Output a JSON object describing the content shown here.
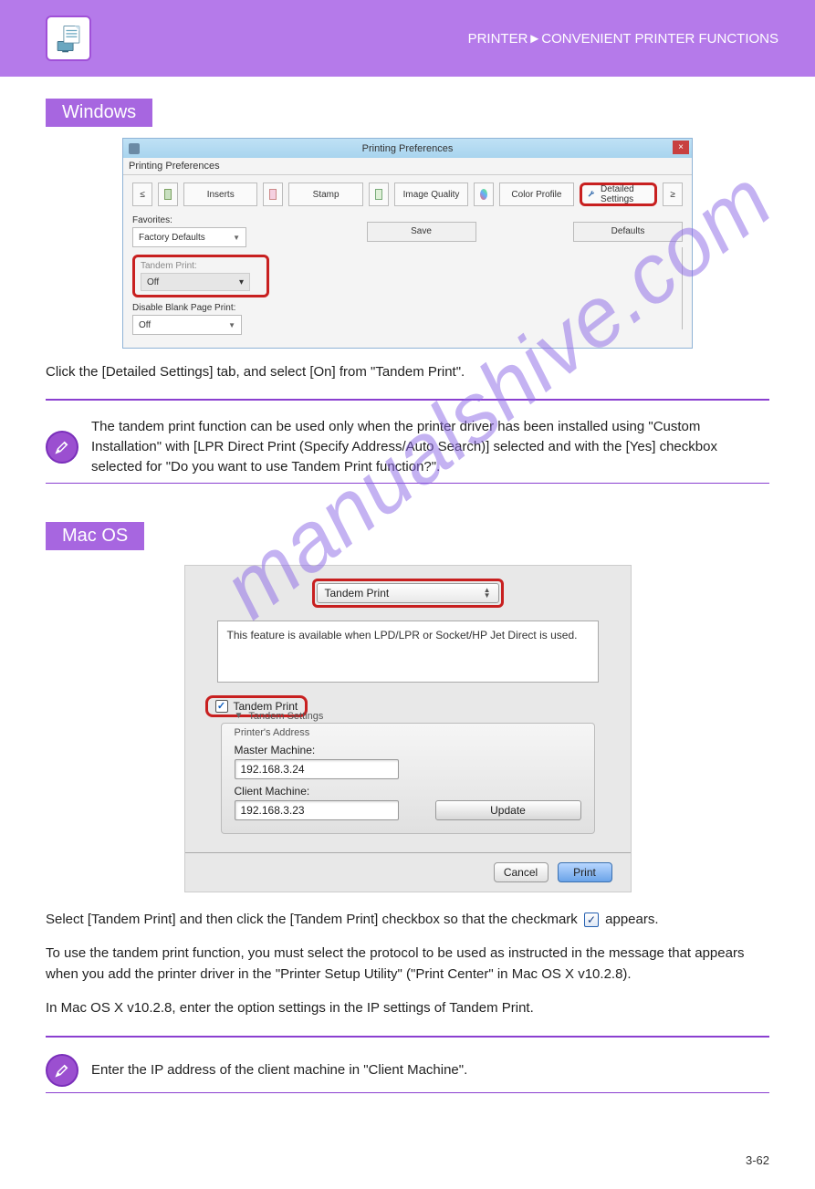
{
  "header": {
    "breadcrumb": "PRINTER►CONVENIENT PRINTER FUNCTIONS"
  },
  "windows": {
    "badge": "Windows",
    "dialog": {
      "title": "Printing Preferences",
      "subtab": "Printing Preferences",
      "tabs": {
        "inserts": "Inserts",
        "stamp": "Stamp",
        "image_quality": "Image Quality",
        "color_profile": "Color Profile",
        "detailed_settings": "Detailed Settings"
      },
      "favorites_label": "Favorites:",
      "favorites_value": "Factory Defaults",
      "save": "Save",
      "defaults": "Defaults",
      "tandem_label": "Tandem Print:",
      "tandem_value": "Off",
      "blank_label": "Disable Blank Page Print:",
      "blank_value": "Off"
    },
    "body_text": "Click the [Detailed Settings] tab, and select [On] from \"Tandem Print\".",
    "note": "The tandem print function can be used only when the printer driver has been installed using \"Custom Installation\" with [LPR Direct Print (Specify Address/Auto Search)] selected and with the [Yes] checkbox selected for \"Do you want to use Tandem Print function?\"."
  },
  "mac": {
    "badge": "Mac OS",
    "dialog": {
      "popup": "Tandem Print",
      "help_text": "This feature is available when LPD/LPR or Socket/HP Jet Direct is used.",
      "checkbox_label": "Tandem Print",
      "group": "Tandem Settings",
      "addr_head": "Printer's Address",
      "master_label": "Master Machine:",
      "master_value": "192.168.3.24",
      "client_label": "Client Machine:",
      "client_value": "192.168.3.23",
      "update": "Update",
      "cancel": "Cancel",
      "print": "Print"
    },
    "instruction": {
      "line1_pre": "Select [Tandem Print] and then click the [Tandem Print] checkbox so that the checkmark ",
      "line1_post": " appears.",
      "line2": "To use the tandem print function, you must select the protocol to be used as instructed in the message that appears when you add the printer driver in the \"Printer Setup Utility\" (\"Print Center\" in Mac OS X v10.2.8).",
      "line3": "In Mac OS X v10.2.8, enter the option settings in the IP settings of Tandem Print."
    },
    "note": "Enter the IP address of the client machine in \"Client Machine\"."
  },
  "page_number": "3-62"
}
